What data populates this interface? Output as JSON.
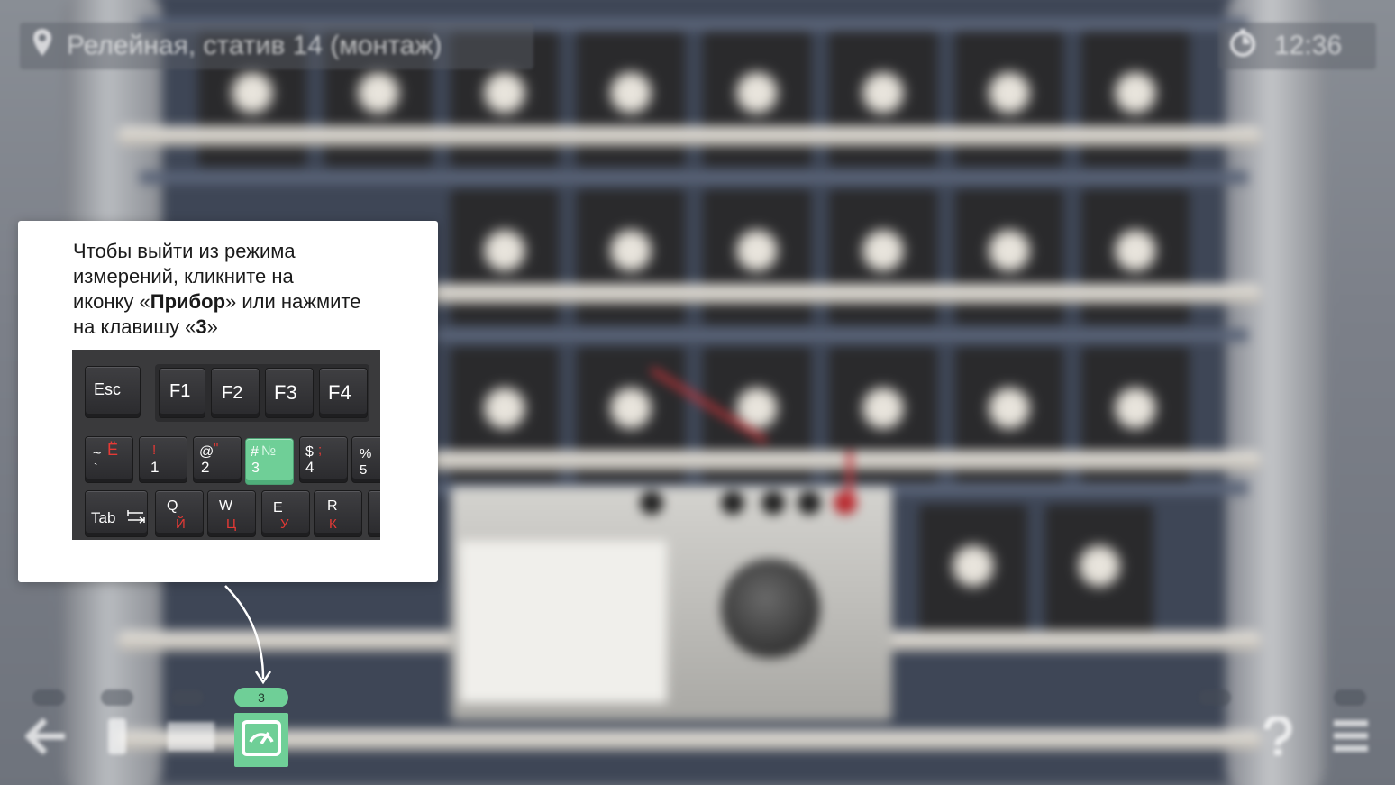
{
  "hud": {
    "location": "Релейная, статив 14 (монтаж)",
    "timer": "12:36",
    "location_icon": "map-pin-icon",
    "timer_icon": "stopwatch-icon"
  },
  "tip": {
    "line1": "Чтобы выйти из режима",
    "line2": "измерений, кликните на",
    "line3_pre": "иконку «",
    "line3_bold": "Прибор",
    "line3_post": "» или нажмите",
    "line4_pre": "на клавишу «",
    "line4_bold": "3",
    "line4_post": "»"
  },
  "keyboard": {
    "esc": "Esc",
    "f1": "F1",
    "f2": "F2",
    "f3": "F3",
    "f4": "F4",
    "tilde": {
      "sym": "~",
      "main": "`",
      "ru": "Ё"
    },
    "k1": {
      "sym": "!",
      "main": "1",
      "ru": "!"
    },
    "k2": {
      "sym": "@",
      "main": "2",
      "ru": "\""
    },
    "k3": {
      "sym": "#",
      "main": "3",
      "ru": "№"
    },
    "k4": {
      "sym": "$",
      "main": "4",
      "ru": ";"
    },
    "k5": {
      "sym": "%",
      "main": "5"
    },
    "tab": "Tab",
    "q": {
      "main": "Q",
      "ru": "Й"
    },
    "w": {
      "main": "W",
      "ru": "Ц"
    },
    "e": {
      "main": "E",
      "ru": "У"
    },
    "r": {
      "main": "R",
      "ru": "К"
    },
    "highlight_color": "#6fcf97"
  },
  "toolbar": {
    "instrument_badge": "3",
    "instrument_icon": "gauge-meter-icon",
    "back_icon": "arrow-left-icon",
    "help_icon": "question-icon",
    "menu_icon": "hamburger-menu-icon",
    "accent_color": "#6fcf97"
  }
}
